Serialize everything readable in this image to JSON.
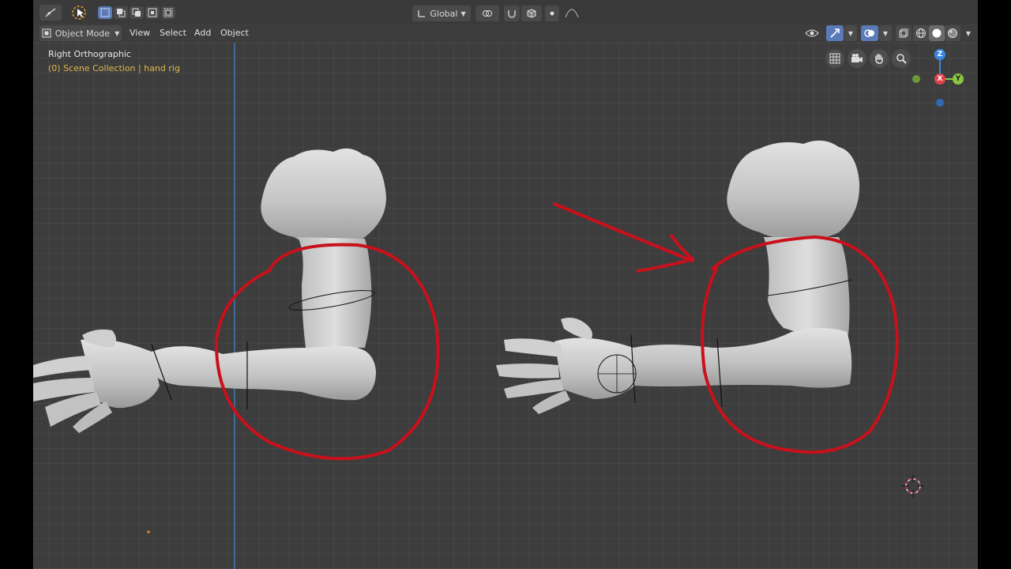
{
  "header": {
    "orientation": "Global",
    "mode": "Object Mode",
    "menus": [
      "View",
      "Select",
      "Add",
      "Object"
    ]
  },
  "overlay": {
    "view_name": "Right Orthographic",
    "collection": "(0) Scene Collection | hand rig"
  },
  "gizmo": {
    "x_label": "X",
    "y_label": "Y",
    "z_label": "Z"
  },
  "colors": {
    "background": "#3d3d3d",
    "annotation": "#c8111b",
    "x_axis": "#e0424a",
    "y_axis": "#8cc63f",
    "z_axis": "#3a86e0",
    "accent": "#5a7bb8"
  }
}
